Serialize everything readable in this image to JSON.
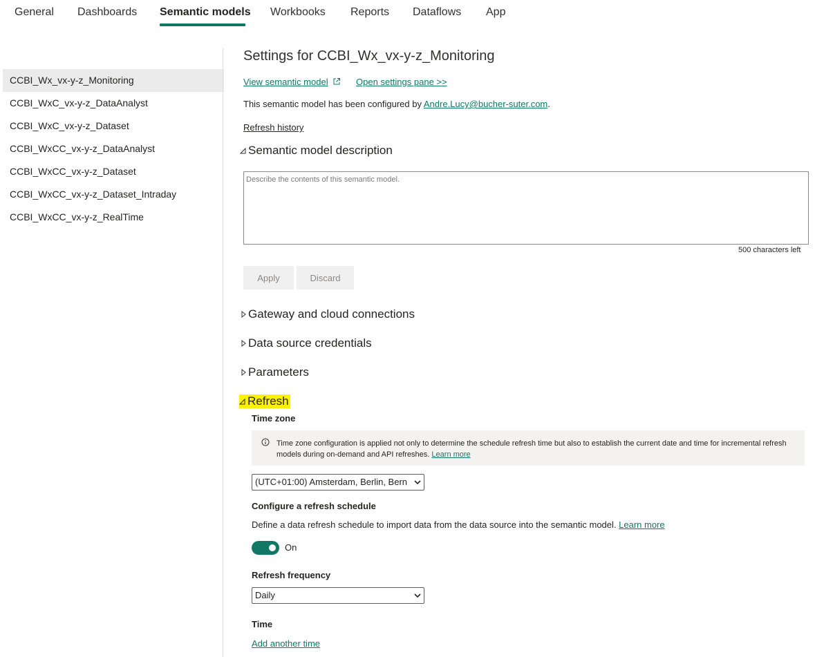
{
  "tabs": [
    {
      "label": "General"
    },
    {
      "label": "Dashboards"
    },
    {
      "label": "Semantic models",
      "active": true
    },
    {
      "label": "Workbooks"
    },
    {
      "label": "Reports"
    },
    {
      "label": "Dataflows"
    },
    {
      "label": "App"
    }
  ],
  "sidebar": {
    "items": [
      {
        "label": "CCBI_Wx_vx-y-z_Monitoring",
        "selected": true
      },
      {
        "label": "CCBI_WxC_vx-y-z_DataAnalyst"
      },
      {
        "label": "CCBI_WxC_vx-y-z_Dataset"
      },
      {
        "label": "CCBI_WxCC_vx-y-z_DataAnalyst"
      },
      {
        "label": "CCBI_WxCC_vx-y-z_Dataset"
      },
      {
        "label": "CCBI_WxCC_vx-y-z_Dataset_Intraday"
      },
      {
        "label": "CCBI_WxCC_vx-y-z_RealTime"
      }
    ]
  },
  "main": {
    "title": "Settings for CCBI_Wx_vx-y-z_Monitoring",
    "view_model_link": "View semantic model",
    "open_settings_link": "Open settings pane >>",
    "configured_by_prefix": "This semantic model has been configured by ",
    "configured_by_user": "Andre.Lucy@bucher-suter.com",
    "configured_by_suffix": ".",
    "refresh_history_link": "Refresh history",
    "description": {
      "header": "Semantic model description",
      "placeholder": "Describe the contents of this semantic model.",
      "value": "",
      "chars_left": "500 characters left",
      "apply_label": "Apply",
      "discard_label": "Discard"
    },
    "sections": {
      "gateway": "Gateway and cloud connections",
      "credentials": "Data source credentials",
      "parameters": "Parameters",
      "refresh": "Refresh"
    },
    "refresh": {
      "time_zone_label": "Time zone",
      "info_text": "Time zone configuration is applied not only to determine the schedule refresh time but also to establish the current date and time for incremental refresh models during on-demand and API refreshes.",
      "info_learn_more": "Learn more",
      "time_zone_value": "(UTC+01:00) Amsterdam, Berlin, Bern",
      "schedule_label": "Configure a refresh schedule",
      "schedule_desc": "Define a data refresh schedule to import data from the data source into the semantic model.",
      "schedule_learn_more": "Learn more",
      "toggle_state": "On",
      "frequency_label": "Refresh frequency",
      "frequency_value": "Daily",
      "time_label": "Time",
      "add_time_link": "Add another time"
    }
  },
  "colors": {
    "accent": "#117865",
    "highlight": "#fff100",
    "selected_bg": "#ebebeb",
    "info_bg": "#f3f2f1"
  },
  "icons": {
    "external": "external-link-icon",
    "info": "info-icon",
    "expanded": "triangle-expanded-icon",
    "collapsed": "triangle-collapsed-icon",
    "dropdown": "chevron-down-icon"
  }
}
